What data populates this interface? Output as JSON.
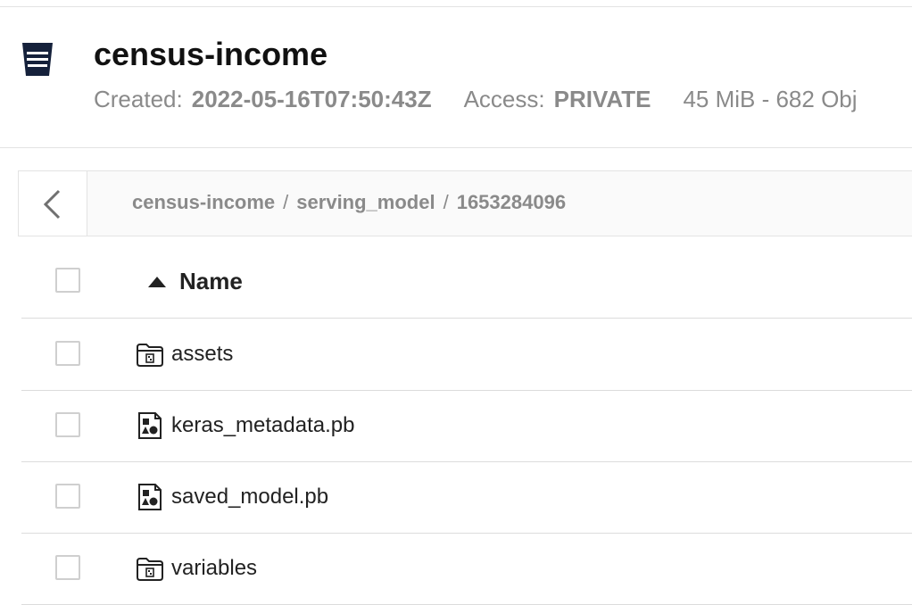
{
  "bucket": {
    "title": "census-income",
    "created_label": "Created:",
    "created_value": "2022-05-16T07:50:43Z",
    "access_label": "Access:",
    "access_value": "PRIVATE",
    "size_summary": "45 MiB - 682 Obj"
  },
  "breadcrumb": {
    "parts": [
      "census-income",
      "serving_model",
      "1653284096"
    ],
    "separator": "/"
  },
  "table": {
    "name_header": "Name",
    "sort_direction": "ascending",
    "rows": [
      {
        "name": "assets",
        "type": "folder"
      },
      {
        "name": "keras_metadata.pb",
        "type": "file"
      },
      {
        "name": "saved_model.pb",
        "type": "file"
      },
      {
        "name": "variables",
        "type": "folder"
      }
    ]
  },
  "colors": {
    "bucket_icon": "#15213b",
    "muted_text": "#8a8a8a",
    "divider": "#dcdcdc"
  }
}
